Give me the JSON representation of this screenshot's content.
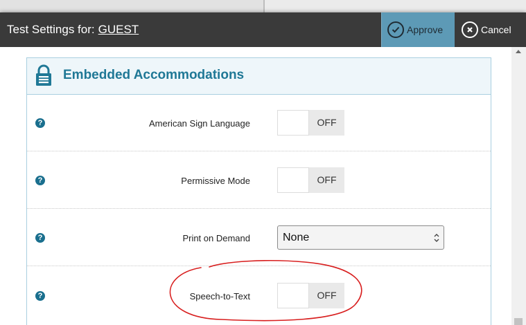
{
  "dialog": {
    "title_prefix": "Test Settings for:",
    "user": "GUEST",
    "approve_label": "Approve",
    "cancel_label": "Cancel"
  },
  "panel": {
    "title": "Embedded Accommodations",
    "icon": "lock-icon"
  },
  "settings": [
    {
      "label": "American Sign Language",
      "control": "toggle",
      "state": "OFF"
    },
    {
      "label": "Permissive Mode",
      "control": "toggle",
      "state": "OFF"
    },
    {
      "label": "Print on Demand",
      "control": "select",
      "value": "None"
    },
    {
      "label": "Speech-to-Text",
      "control": "toggle",
      "state": "OFF"
    }
  ],
  "colors": {
    "titlebar": "#3a3a3a",
    "approve_bg": "#5d9ab6",
    "panel_title": "#1f7896",
    "help_icon": "#1a6f8e",
    "annotation": "#d81e1e"
  }
}
